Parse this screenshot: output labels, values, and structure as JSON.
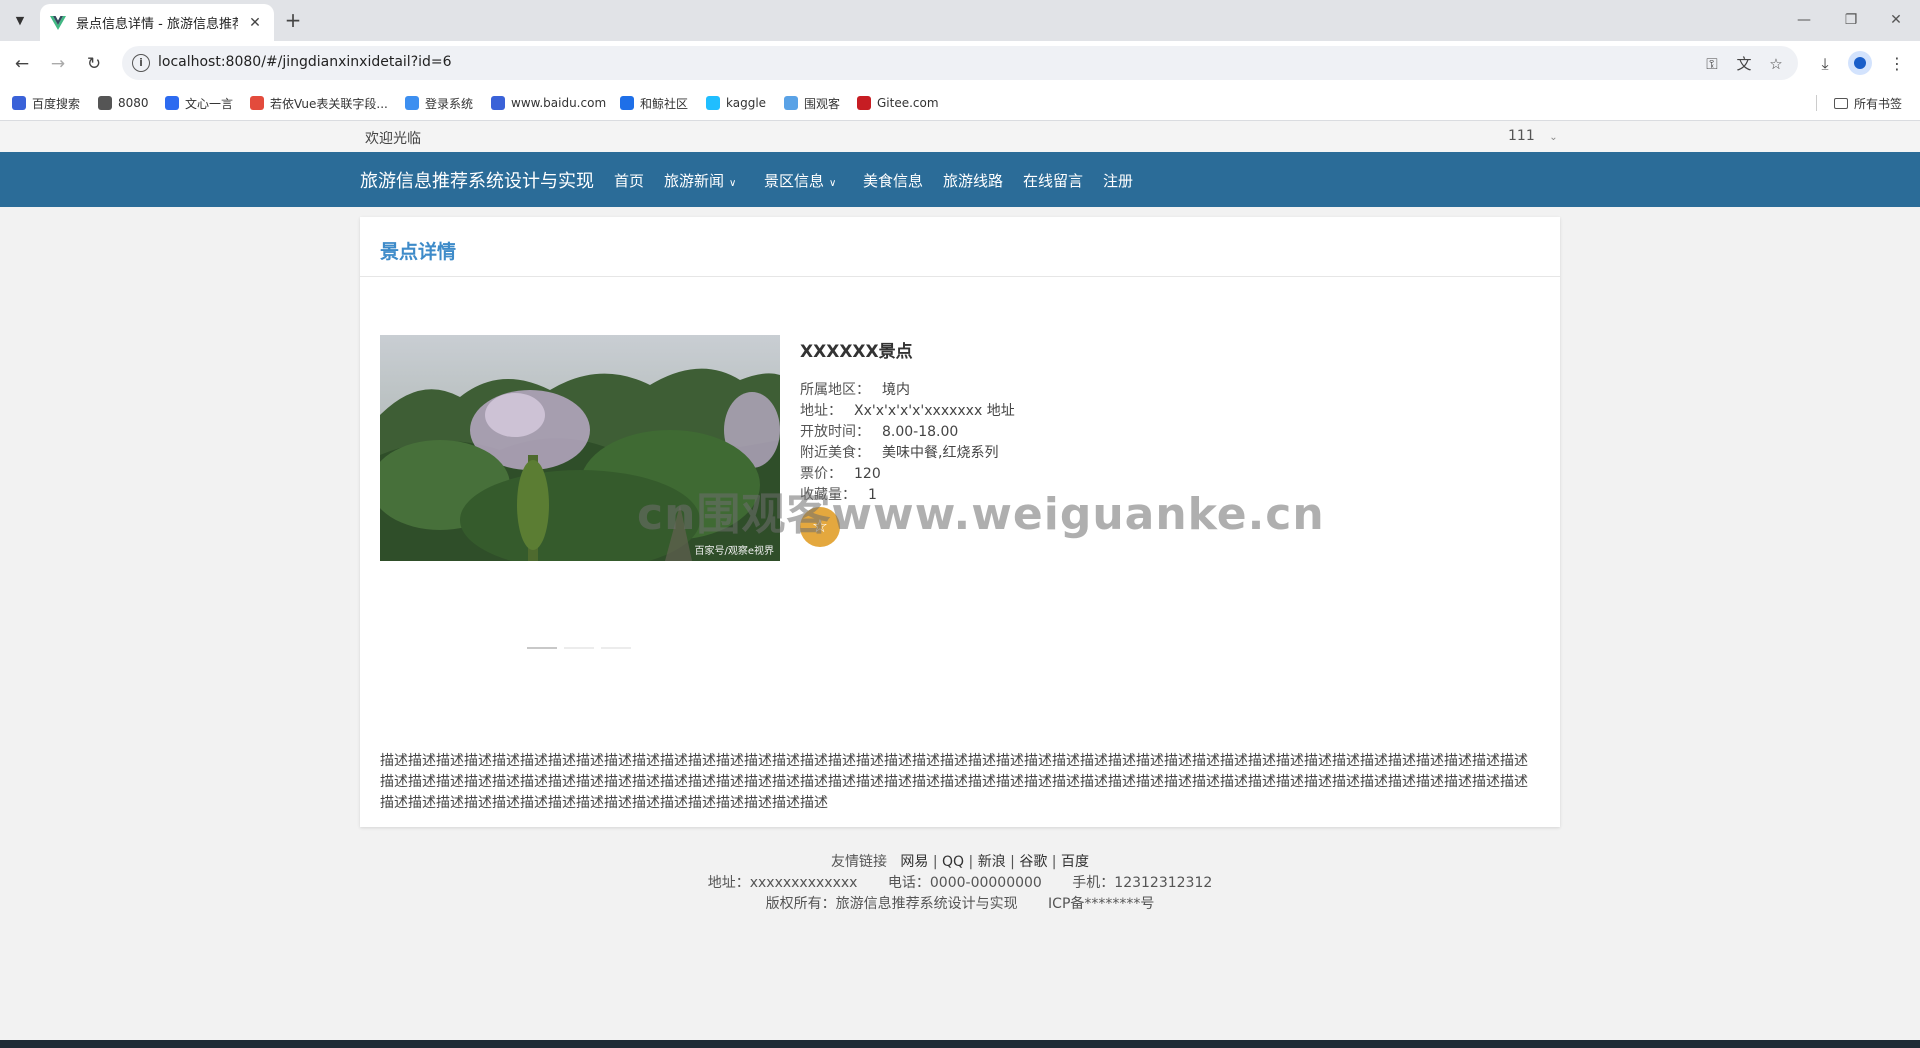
{
  "browser": {
    "tab_title": "景点信息详情 - 旅游信息推荐系统",
    "url": "localhost:8080/#/jingdianxinxidetail?id=6",
    "bookmarks": [
      {
        "label": "百度搜索",
        "color": "#3a62d8",
        "icon": "paw-icon"
      },
      {
        "label": "8080",
        "color": "#555555",
        "icon": "globe-icon"
      },
      {
        "label": "文心一言",
        "color": "#2d6bf0",
        "icon": "wenxin-icon"
      },
      {
        "label": "若依Vue表关联字段...",
        "color": "#e34b3c",
        "icon": "ruoyi-icon"
      },
      {
        "label": "登录系统",
        "color": "#3d8ff0",
        "icon": "login-icon"
      },
      {
        "label": "www.baidu.com",
        "color": "#3a62d8",
        "icon": "paw-icon"
      },
      {
        "label": "和鲸社区",
        "color": "#1e6fe8",
        "icon": "heywhale-icon"
      },
      {
        "label": "kaggle",
        "color": "#20beff",
        "icon": "kaggle-icon"
      },
      {
        "label": "围观客",
        "color": "#5aa2e6",
        "icon": "weiguanke-icon"
      },
      {
        "label": "Gitee.com",
        "color": "#c71d23",
        "icon": "gitee-icon"
      }
    ],
    "all_bookmarks": "所有书签"
  },
  "header": {
    "welcome": "欢迎光临",
    "user": "111"
  },
  "nav": {
    "brand": "旅游信息推荐系统设计与实现",
    "items": [
      {
        "label": "首页",
        "dropdown": false
      },
      {
        "label": "旅游新闻",
        "dropdown": true
      },
      {
        "label": "景区信息",
        "dropdown": true
      },
      {
        "label": "美食信息",
        "dropdown": false
      },
      {
        "label": "旅游线路",
        "dropdown": false
      },
      {
        "label": "在线留言",
        "dropdown": false
      },
      {
        "label": "注册",
        "dropdown": false
      }
    ]
  },
  "detail": {
    "panel_title": "景点详情",
    "name": "XXXXXX景点",
    "photo_credit": "百家号/观察e视界",
    "attributes": [
      {
        "label": "所属地区：",
        "value": "境内"
      },
      {
        "label": "地址：",
        "value": "Xx'x'x'x'x'xxxxxxx 地址"
      },
      {
        "label": "开放时间：",
        "value": "8.00-18.00"
      },
      {
        "label": "附近美食：",
        "value": "美味中餐,红烧系列"
      },
      {
        "label": "票价：",
        "value": "120"
      },
      {
        "label": "收藏量：",
        "value": "1"
      }
    ],
    "carousel": {
      "slides": 3,
      "active": 0
    },
    "description": "描述描述描述描述描述描述描述描述描述描述描述描述描述描述描述描述描述描述描述描述描述描述描述描述描述描述描述描述描述描述描述描述描述描述描述描述描述描述描述描述描述描述描述描述描述描述描述描述描述描述描述描述描述描述描述描述描述描述描述描述描述描述描述描述描述描述描述描述描述描述描述描述描述描述描述描述描述描述描述描述描述描述描述描述描述描述描述描述描述描述描述描述描述描述描述描述描述描述"
  },
  "footer": {
    "links_label": "友情链接",
    "links": [
      "网易",
      "QQ",
      "新浪",
      "谷歌",
      "百度"
    ],
    "address": "地址：xxxxxxxxxxxxx",
    "phone": "电话：0000-00000000",
    "mobile": "手机：12312312312",
    "copyright": "版权所有：旅游信息推荐系统设计与实现",
    "icp": "ICP备********号"
  },
  "watermark": "cn围观客www.weiguanke.cn",
  "colors": {
    "navbar": "#2b6c98",
    "accent": "#3e8bc9",
    "favorite": "#e4a83e"
  }
}
